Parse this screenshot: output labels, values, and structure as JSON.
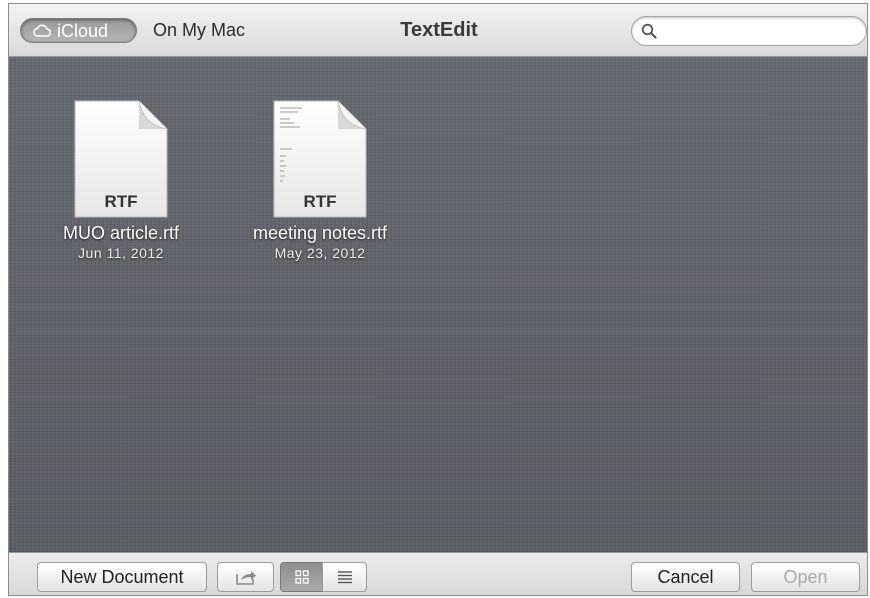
{
  "window": {
    "title": "TextEdit"
  },
  "toolbar": {
    "icloud_label": "iCloud",
    "on_my_mac_label": "On My Mac",
    "search_value": "",
    "search_placeholder": ""
  },
  "files": [
    {
      "name": "MUO article.rtf",
      "date": "Jun 11, 2012",
      "type": "RTF"
    },
    {
      "name": "meeting notes.rtf",
      "date": "May 23, 2012",
      "type": "RTF"
    }
  ],
  "bottombar": {
    "new_document_label": "New Document",
    "cancel_label": "Cancel",
    "open_label": "Open",
    "view_mode": "icon"
  },
  "icons": [
    "cloud-icon",
    "search-icon",
    "share-icon",
    "grid-view-icon",
    "list-view-icon",
    "document-icon"
  ],
  "colors": {
    "content_bg": "#5d6066",
    "open_disabled_text": "#a8a8a8"
  }
}
